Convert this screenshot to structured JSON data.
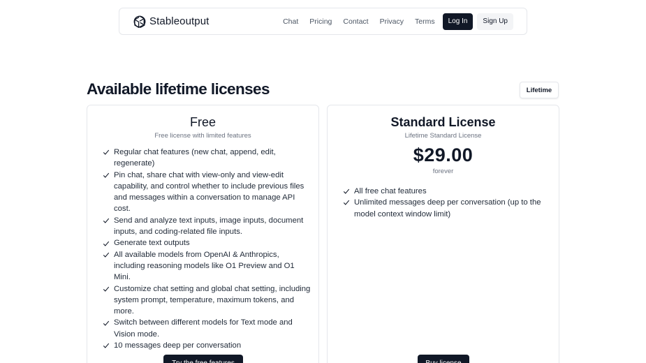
{
  "brand": {
    "name": "Stableoutput",
    "logo_icon": "openai-knot-icon"
  },
  "nav": {
    "links": [
      "Chat",
      "Pricing",
      "Contact",
      "Privacy",
      "Terms"
    ],
    "login_label": "Log In",
    "signup_label": "Sign Up"
  },
  "section": {
    "title": "Available lifetime licenses",
    "tab_label": "Lifetime"
  },
  "plans": [
    {
      "name": "Free",
      "subtitle": "Free license with limited features",
      "features": [
        "Regular chat features (new chat, append, edit, regenerate)",
        "Pin chat, share chat with view-only and view-edit capability, and control whether to include previous files and messages within a conversation to manage API cost.",
        "Send and analyze text inputs, image inputs, document inputs, and coding-related file inputs.",
        "Generate text outputs",
        "All available models from OpenAI & Anthropics, including reasoning models like O1 Preview and O1 Mini.",
        "Customize chat setting and global chat setting, including system prompt, temperature, maximum tokens, and more.",
        "Switch between different models for Text mode and Vision mode.",
        "10 messages deep per conversation"
      ],
      "cta_label": "Try the free features"
    },
    {
      "name": "Standard License",
      "subtitle": "Lifetime Standard License",
      "price": "$29.00",
      "period": "forever",
      "features": [
        "All free chat features",
        "Unlimited messages deep per conversation (up to the model context window limit)"
      ],
      "cta_label": "Buy license"
    }
  ],
  "colors": {
    "primary": "#111827",
    "muted": "#6b7280",
    "border": "#e5e7eb"
  }
}
